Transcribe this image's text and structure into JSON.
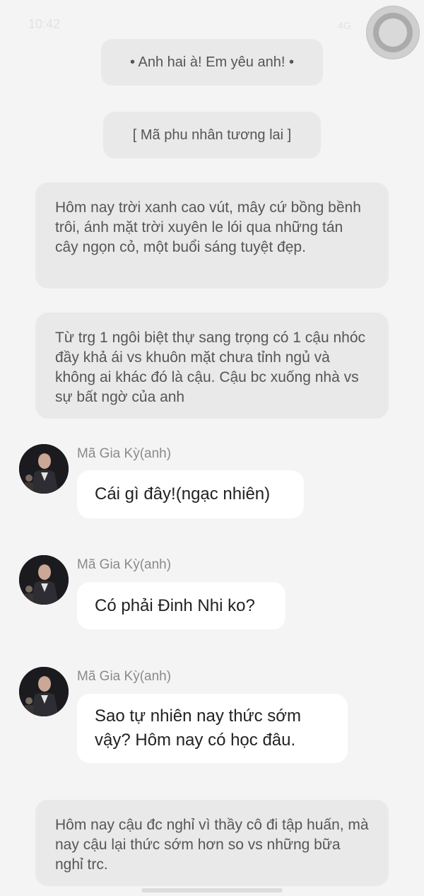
{
  "status_bar": {
    "time": "10:42",
    "signal": "4G"
  },
  "icons": {
    "battery": "battery-charging-icon",
    "overlay": "floating-assistive-touch-icon",
    "avatar": "profile-photo"
  },
  "colors": {
    "background": "#f4f4f4",
    "narration_bg": "#e9e9e9",
    "message_bg": "#ffffff",
    "sender_text": "#8a8a8a"
  },
  "chat": {
    "title_pill": "• Anh hai à! Em yêu anh! •",
    "chapter_pill": "[ Mã phu nhân tương lai ]",
    "narration_1": "Hôm nay trời xanh cao vút, mây cứ bồng bềnh trôi, ánh mặt trời xuyên le lói qua những tán cây ngọn cỏ, một buổi sáng tuyệt đẹp.",
    "narration_2": "Từ trg 1 ngôi biệt thự sang trọng có 1 cậu nhóc đầy khả ái vs khuôn mặt chưa tỉnh ngủ và không ai khác đó là cậu. Cậu bc xuống nhà vs sự bất ngờ của anh",
    "messages": [
      {
        "sender": "Mã Gia Kỳ(anh)",
        "text": "Cái gì đây!(ngạc nhiên)"
      },
      {
        "sender": "Mã Gia Kỳ(anh)",
        "text": "Có phải Đinh Nhi ko?"
      },
      {
        "sender": "Mã Gia Kỳ(anh)",
        "text": "Sao tự nhiên nay thức sớm vậy? Hôm nay có học đâu."
      }
    ],
    "narration_3": "Hôm nay cậu đc nghỉ vì thầy cô đi tập huấn, mà nay cậu lại thức sớm hơn so vs những bữa nghỉ trc."
  }
}
